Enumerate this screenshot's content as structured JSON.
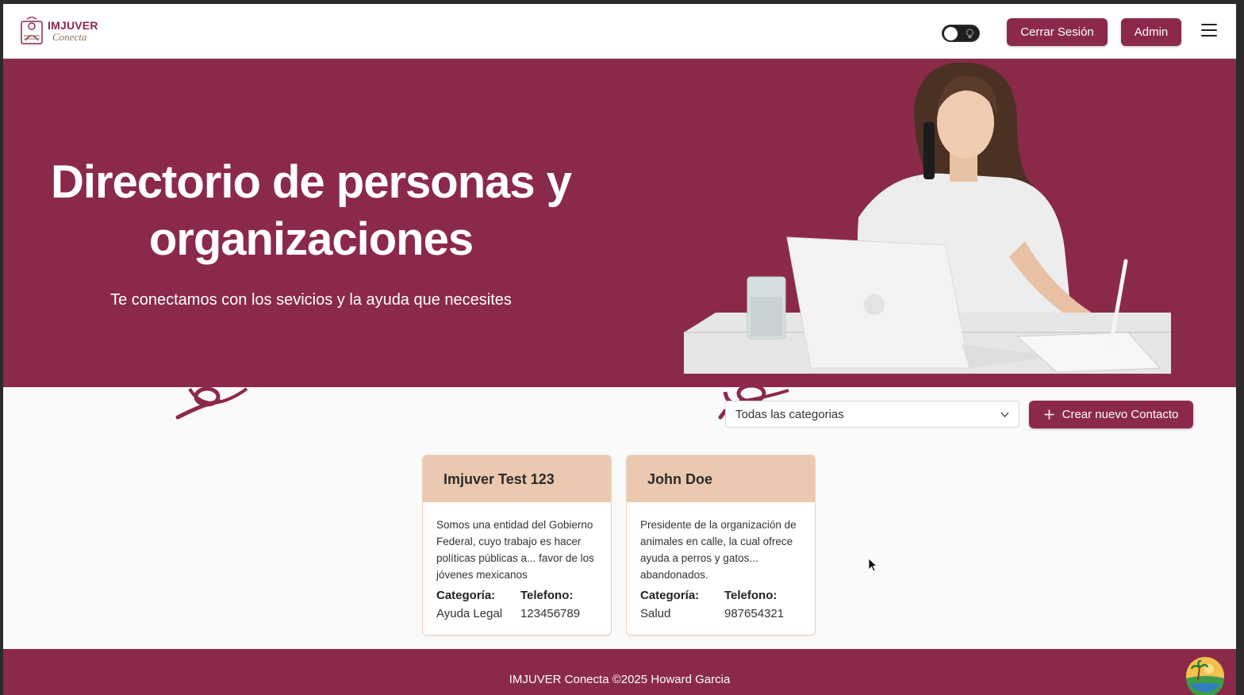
{
  "brand": {
    "title": "IMJUVER",
    "subtitle": "Conecta"
  },
  "header": {
    "logout_label": "Cerrar Sesión",
    "admin_label": "Admin"
  },
  "hero": {
    "title": "Directorio de personas y organizaciones",
    "subtitle": "Te conectamos con los sevicios y la ayuda que necesites"
  },
  "filter": {
    "selected_category": "Todas las categorias",
    "create_label": "Crear nuevo Contacto"
  },
  "contacts": [
    {
      "name": "Imjuver Test 123",
      "description": "Somos una entidad del Gobierno Federal, cuyo trabajo es hacer políticas públicas a... favor de los jóvenes mexicanos",
      "category_label": "Categoría:",
      "category": "Ayuda Legal",
      "phone_label": "Telefono:",
      "phone": "123456789"
    },
    {
      "name": "John Doe",
      "description": "Presidente de la organización de animales en calle, la cual ofrece ayuda a perros y gatos... abandonados.",
      "category_label": "Categoría:",
      "category": "Salud",
      "phone_label": "Telefono:",
      "phone": "987654321"
    }
  ],
  "footer": {
    "text": "IMJUVER Conecta ©2025 Howard Garcia"
  },
  "colors": {
    "primary": "#8b2949",
    "card_header": "#ebc8b0",
    "logo_accent": "#8a6f57"
  },
  "icons": {
    "logo": "imjuver-logo-icon",
    "theme_toggle": "lightbulb-icon",
    "menu": "hamburger-menu-icon",
    "select": "chevron-down-icon",
    "create": "plus-icon",
    "floating": "avatar-beach-icon"
  }
}
